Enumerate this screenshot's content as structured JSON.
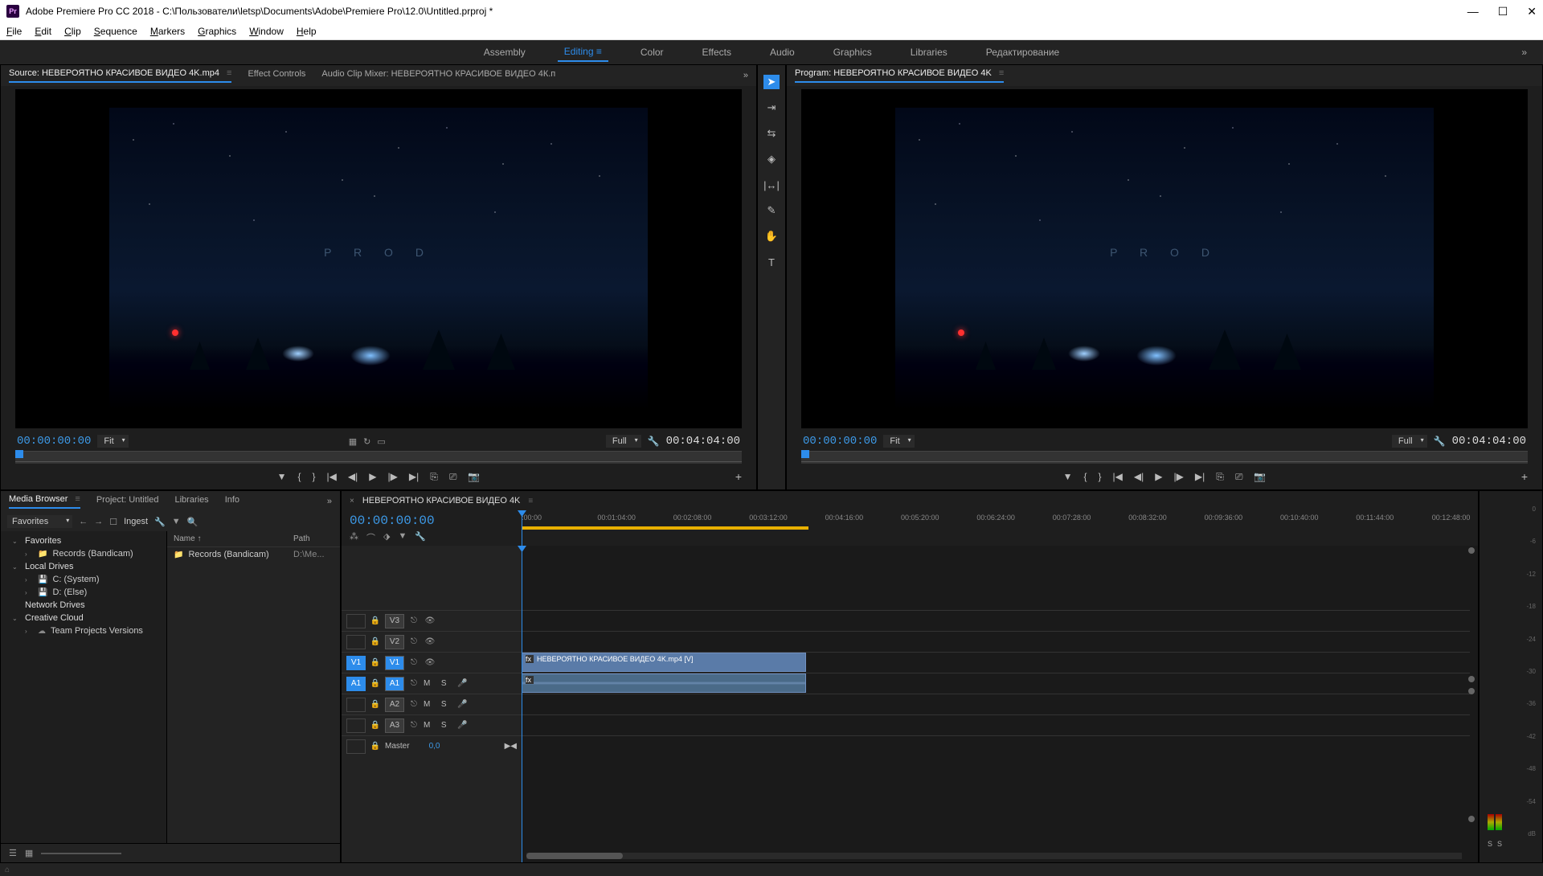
{
  "titlebar": {
    "app": "Adobe Premiere Pro CC 2018",
    "path": "C:\\Пользователи\\letsp\\Documents\\Adobe\\Premiere Pro\\12.0\\Untitled.prproj *",
    "logo": "Pr"
  },
  "menubar": [
    "File",
    "Edit",
    "Clip",
    "Sequence",
    "Markers",
    "Graphics",
    "Window",
    "Help"
  ],
  "workspaces": {
    "items": [
      "Assembly",
      "Editing",
      "Color",
      "Effects",
      "Audio",
      "Graphics",
      "Libraries",
      "Редактирование"
    ],
    "active": "Editing"
  },
  "source": {
    "tabs": {
      "main": "Source: НЕВЕРОЯТНО КРАСИВОЕ ВИДЕО 4K.mp4",
      "effect": "Effect Controls",
      "mixer": "Audio Clip Mixer: НЕВЕРОЯТНО КРАСИВОЕ ВИДЕО 4К.п"
    },
    "video_text": "P R O D",
    "timecode_in": "00:00:00:00",
    "timecode_out": "00:04:04:00",
    "fit": "Fit",
    "quality": "Full"
  },
  "program": {
    "tab": "Program: НЕВЕРОЯТНО КРАСИВОЕ ВИДЕО 4K",
    "timecode_in": "00:00:00:00",
    "timecode_out": "00:04:04:00",
    "fit": "Fit",
    "quality": "Full"
  },
  "project": {
    "tabs": {
      "browser": "Media Browser",
      "project": "Project: Untitled",
      "libraries": "Libraries",
      "info": "Info"
    },
    "toolbar": {
      "favorites": "Favorites",
      "ingest": "Ingest"
    },
    "tree": {
      "favorites": "Favorites",
      "records": "Records (Bandicam)",
      "local": "Local Drives",
      "c": "C: (System)",
      "d": "D: (Else)",
      "network": "Network Drives",
      "cloud": "Creative Cloud",
      "team": "Team Projects Versions"
    },
    "list": {
      "headers": {
        "name": "Name ↑",
        "path": "Path"
      },
      "row": {
        "name": "Records (Bandicam)",
        "path": "D:\\Me..."
      }
    }
  },
  "timeline": {
    "sequence": "НЕВЕРОЯТНО КРАСИВОЕ ВИДЕО 4K",
    "timecode": "00:00:00:00",
    "ruler": [
      ":00:00",
      "00:01:04:00",
      "00:02:08:00",
      "00:03:12:00",
      "00:04:16:00",
      "00:05:20:00",
      "00:06:24:00",
      "00:07:28:00",
      "00:08:32:00",
      "00:09:36:00",
      "00:10:40:00",
      "00:11:44:00",
      "00:12:48:00"
    ],
    "tracks": {
      "v3": "V3",
      "v2": "V2",
      "v1": "V1",
      "a1": "A1",
      "a2": "A2",
      "a3": "A3",
      "src_v1": "V1",
      "src_a1": "A1",
      "master": "Master",
      "master_val": "0,0",
      "m": "M",
      "s": "S"
    },
    "clip_name": "НЕВЕРОЯТНО КРАСИВОЕ ВИДЕО 4K.mp4 [V]"
  },
  "audiometer": {
    "db_labels": [
      "0",
      "-6",
      "-12",
      "-18",
      "-24",
      "-30",
      "-36",
      "-42",
      "-48",
      "-54",
      "dB"
    ],
    "solo": {
      "s1": "S",
      "s2": "S"
    }
  }
}
